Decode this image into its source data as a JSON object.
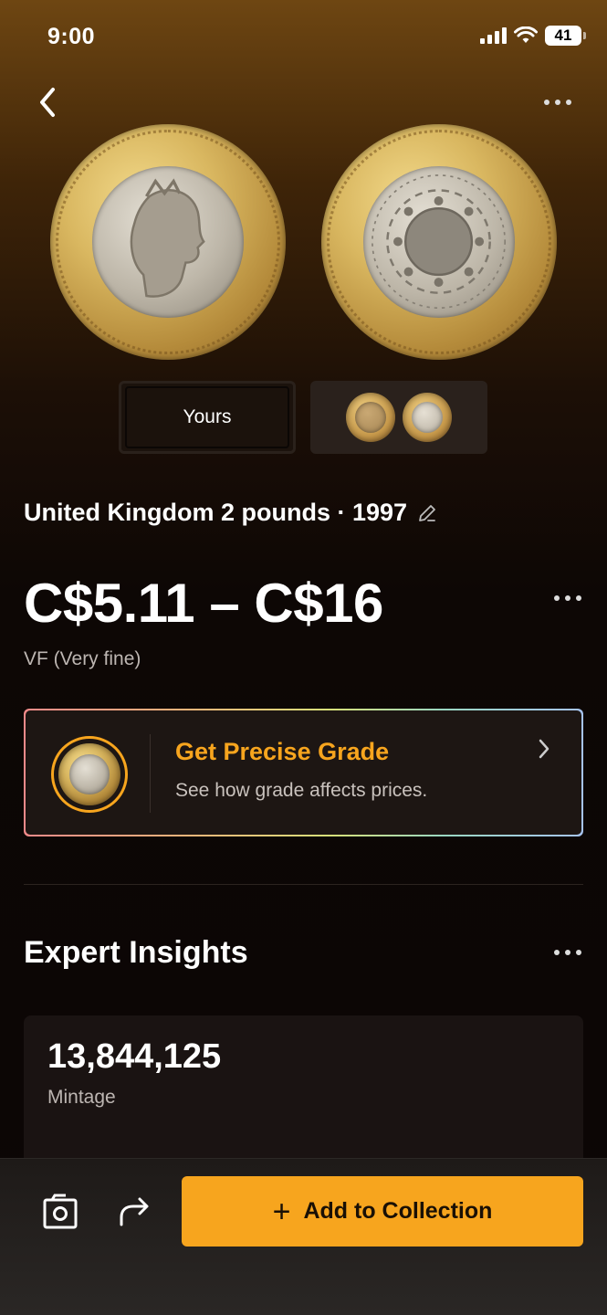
{
  "status": {
    "time": "9:00",
    "battery": "41"
  },
  "coin": {
    "title": "United Kingdom 2 pounds · 1997",
    "price_range": "C$5.11 – C$16",
    "grade": "VF (Very fine)"
  },
  "tabs": {
    "yours_label": "Yours"
  },
  "grade_card": {
    "title": "Get Precise Grade",
    "subtitle": "See how grade affects prices."
  },
  "insights": {
    "title": "Expert Insights",
    "mintage_value": "13,844,125",
    "mintage_label": "Mintage"
  },
  "bottom": {
    "add_label": "Add to Collection"
  },
  "colors": {
    "accent": "#f7a51e",
    "background": "#0b0605",
    "card": "#1d1613"
  },
  "icons": [
    "back-chevron-icon",
    "more-icon",
    "edit-pencil-icon",
    "chevron-right-icon",
    "camera-icon",
    "share-icon",
    "plus-icon"
  ]
}
